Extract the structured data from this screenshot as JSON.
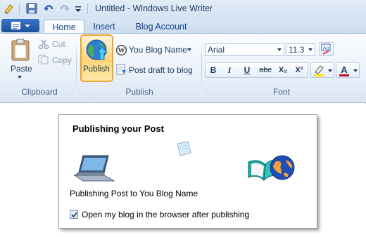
{
  "window": {
    "title": "Untitled - Windows Live Writer"
  },
  "quick_access": {
    "icons": [
      "save-icon",
      "undo-icon",
      "redo-icon",
      "customize-icon"
    ]
  },
  "tabs": [
    "Home",
    "Insert",
    "Blog Account"
  ],
  "active_tab": "Home",
  "clipboard": {
    "paste": "Paste",
    "cut": "Cut",
    "copy": "Copy",
    "label": "Clipboard"
  },
  "publish_group": {
    "publish": "Publish",
    "blog_name": "You Blog Name",
    "post_draft": "Post draft to blog",
    "label": "Publish"
  },
  "font_group": {
    "font": "Arial",
    "size": "11.3",
    "bold": "B",
    "italic": "I",
    "underline": "U",
    "strikethrough": "abc",
    "subscript": "X₂",
    "superscript": "X²",
    "highlight_color": "#ffe400",
    "font_color": "#c0111a",
    "label": "Font"
  },
  "dialog": {
    "title": "Publishing your Post",
    "status": "Publishing Post to You Blog Name",
    "open_in_browser_label": "Open my blog in the browser after publishing",
    "open_in_browser_checked": true
  },
  "colors": {
    "accent": "#1b4f9c",
    "publish_highlight": "#e8a431"
  }
}
